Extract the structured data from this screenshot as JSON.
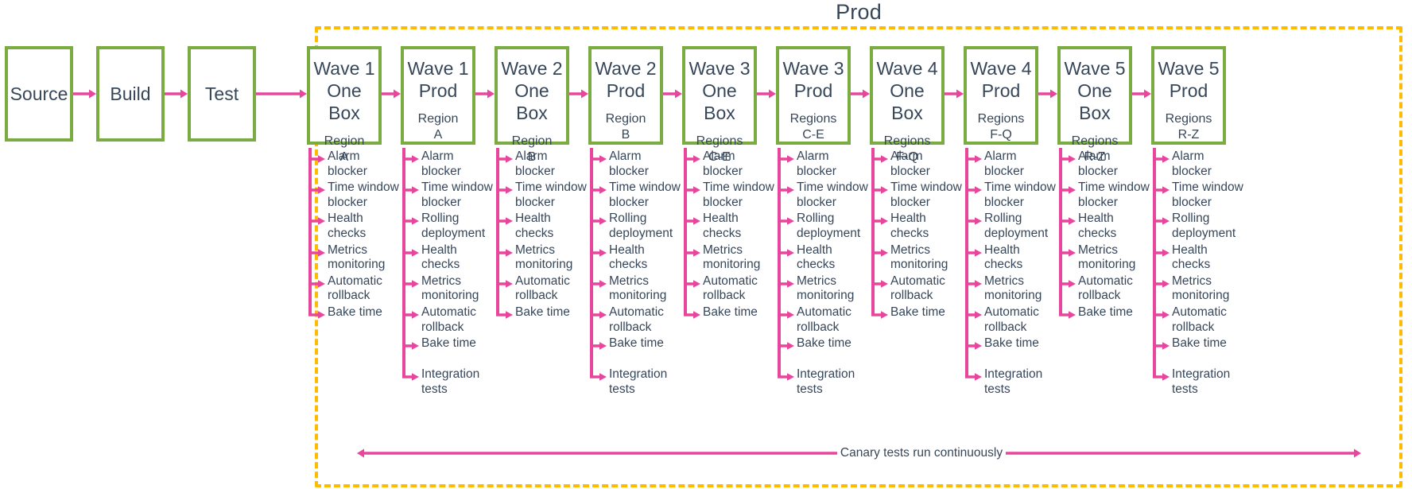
{
  "diagram": {
    "group": {
      "label": "Prod",
      "border_color": "#FFBB00",
      "border_style": "dashed"
    },
    "colors": {
      "box_border_green": "#7AAC42",
      "arrow_pink": "#E8459C",
      "text_slate": "#37475A",
      "group_orange": "#FFBB00"
    },
    "pre_stages": [
      {
        "title": "Source"
      },
      {
        "title": "Build"
      },
      {
        "title": "Test"
      }
    ],
    "waves": [
      {
        "title": "Wave 1\nOne Box",
        "subtitle": "Region\nA",
        "steps": [
          "Alarm\nblocker",
          "Time window\nblocker",
          "Health\nchecks",
          "Metrics\nmonitoring",
          "Automatic\nrollback",
          "Bake time"
        ]
      },
      {
        "title": "Wave 1\nProd",
        "subtitle": "Region\nA",
        "steps": [
          "Alarm\nblocker",
          "Time window\nblocker",
          "Rolling\ndeployment",
          "Health\nchecks",
          "Metrics\nmonitoring",
          "Automatic\nrollback",
          "Bake time",
          "Integration\ntests"
        ]
      },
      {
        "title": "Wave 2\nOne Box",
        "subtitle": "Region\nB",
        "steps": [
          "Alarm\nblocker",
          "Time window\nblocker",
          "Health\nchecks",
          "Metrics\nmonitoring",
          "Automatic\nrollback",
          "Bake time"
        ]
      },
      {
        "title": "Wave 2\nProd",
        "subtitle": "Region\nB",
        "steps": [
          "Alarm\nblocker",
          "Time window\nblocker",
          "Rolling\ndeployment",
          "Health\nchecks",
          "Metrics\nmonitoring",
          "Automatic\nrollback",
          "Bake time",
          "Integration\ntests"
        ]
      },
      {
        "title": "Wave 3\nOne Box",
        "subtitle": "Regions\nC-E",
        "steps": [
          "Alarm\nblocker",
          "Time window\nblocker",
          "Health\nchecks",
          "Metrics\nmonitoring",
          "Automatic\nrollback",
          "Bake time"
        ]
      },
      {
        "title": "Wave 3\nProd",
        "subtitle": "Regions\nC-E",
        "steps": [
          "Alarm\nblocker",
          "Time window\nblocker",
          "Rolling\ndeployment",
          "Health\nchecks",
          "Metrics\nmonitoring",
          "Automatic\nrollback",
          "Bake time",
          "Integration\ntests"
        ]
      },
      {
        "title": "Wave 4\nOne Box",
        "subtitle": "Regions\nF-Q",
        "steps": [
          "Alarm\nblocker",
          "Time window\nblocker",
          "Health\nchecks",
          "Metrics\nmonitoring",
          "Automatic\nrollback",
          "Bake time"
        ]
      },
      {
        "title": "Wave 4\nProd",
        "subtitle": "Regions\nF-Q",
        "steps": [
          "Alarm\nblocker",
          "Time window\nblocker",
          "Rolling\ndeployment",
          "Health\nchecks",
          "Metrics\nmonitoring",
          "Automatic\nrollback",
          "Bake time",
          "Integration\ntests"
        ]
      },
      {
        "title": "Wave 5\nOne Box",
        "subtitle": "Regions\nR-Z",
        "steps": [
          "Alarm\nblocker",
          "Time window\nblocker",
          "Health\nchecks",
          "Metrics\nmonitoring",
          "Automatic\nrollback",
          "Bake time"
        ]
      },
      {
        "title": "Wave 5\nProd",
        "subtitle": "Regions\nR-Z",
        "steps": [
          "Alarm\nblocker",
          "Time window\nblocker",
          "Rolling\ndeployment",
          "Health\nchecks",
          "Metrics\nmonitoring",
          "Automatic\nrollback",
          "Bake time",
          "Integration\ntests"
        ]
      }
    ],
    "canary": {
      "label": "Canary tests run continuously"
    }
  }
}
